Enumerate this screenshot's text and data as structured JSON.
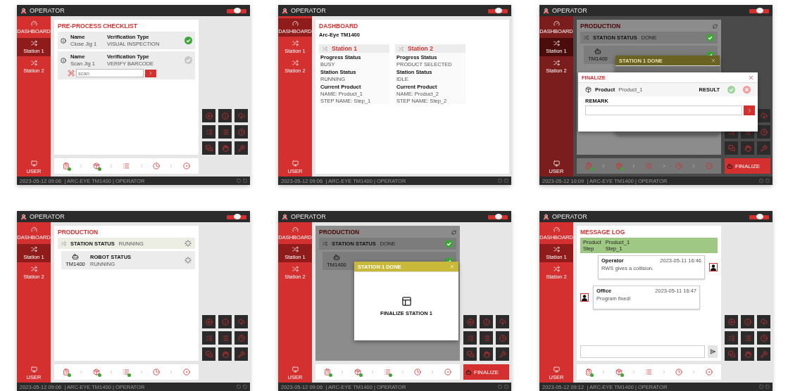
{
  "panels": [
    {
      "kind": "checklist",
      "header": {
        "title": "OPERATOR"
      },
      "sidebar": {
        "items": [
          {
            "label": "DASHBOARD",
            "selected": false
          },
          {
            "label": "Station 1",
            "selected": true
          },
          {
            "label": "Station 2",
            "selected": false
          }
        ],
        "user": "USER"
      },
      "content": {
        "title": "PRE-PROCESS CHECKLIST",
        "items": [
          {
            "name_label": "Name",
            "name": "Close Jig 1",
            "type_label": "Verification Type",
            "type": "VISUAL INSPECTION",
            "checked": true
          },
          {
            "name_label": "Name",
            "name": "Scan Jig 1",
            "type_label": "Verification Type",
            "type": "VERIFY BARCODE",
            "checked": false,
            "scan_placeholder": "scan"
          }
        ]
      },
      "actions_visible": true,
      "steps": [
        {
          "done": true
        },
        {
          "done": true
        },
        {
          "done": false
        },
        {
          "done": false
        },
        {
          "done": false
        }
      ],
      "status_bar": "2023-05-12 09:06  | ARC-EYE TM1400 | OPERATOR"
    },
    {
      "kind": "dashboard",
      "header": {
        "title": "OPERATOR"
      },
      "sidebar": {
        "items": [
          {
            "label": "DASHBOARD",
            "selected": true
          },
          {
            "label": "Station 1",
            "selected": false
          },
          {
            "label": "Station 2",
            "selected": false
          }
        ],
        "user": "USER"
      },
      "content": {
        "title": "DASHBOARD",
        "subtitle": "Arc-Eye TM1400",
        "stations": [
          {
            "name": "Station 1",
            "fields": [
              {
                "label": "Progress Status",
                "values": [
                  "BUSY"
                ]
              },
              {
                "label": "Station Status",
                "values": [
                  "RUNNING"
                ]
              },
              {
                "label": "Current Product",
                "values": [
                  "NAME: Product_1",
                  "STEP NAME: Step_1"
                ]
              }
            ]
          },
          {
            "name": "Station 2",
            "fields": [
              {
                "label": "Progress Status",
                "values": [
                  "PRODUCT SELECTED"
                ]
              },
              {
                "label": "Station Status",
                "values": [
                  "IDLE"
                ]
              },
              {
                "label": "Current Product",
                "values": [
                  "NAME: Product_2",
                  "STEP NAME: Step_2"
                ]
              }
            ]
          }
        ]
      },
      "actions_visible": false,
      "status_bar": "2023-05-12 09:06  | ARC-EYE TM1400 | OPERATOR"
    },
    {
      "kind": "production",
      "header": {
        "title": "OPERATOR"
      },
      "sidebar": {
        "items": [
          {
            "label": "DASHBOARD",
            "selected": false
          },
          {
            "label": "Station 1",
            "selected": true
          },
          {
            "label": "Station 2",
            "selected": false
          }
        ],
        "user": "USER"
      },
      "content": {
        "title": "PRODUCTION",
        "station": {
          "label": "STATION STATUS",
          "value": "DONE",
          "done": true
        },
        "robot": {
          "caption": "TM1400",
          "done": true
        }
      },
      "actions_visible": true,
      "steps": [
        {
          "done": true
        },
        {
          "done": true
        },
        {
          "done": false
        },
        {
          "done": false
        },
        {
          "done": false
        }
      ],
      "finalize_button": "FINALIZE",
      "content_dimmed": true,
      "screen_dimmed": true,
      "dialogs": [
        {
          "kind": "notice",
          "title": "STATION 1 DONE",
          "dimmed": true
        },
        {
          "kind": "finalize",
          "title": "FINALIZE",
          "product_label": "Product",
          "product": "Product_1",
          "result_label": "RESULT",
          "remark_label": "REMARK"
        }
      ],
      "status_bar": "2023-05-12 10:09  | ARC-EYE TM1400 | OPERATOR"
    },
    {
      "kind": "production",
      "header": {
        "title": "OPERATOR"
      },
      "sidebar": {
        "items": [
          {
            "label": "DASHBOARD",
            "selected": false
          },
          {
            "label": "Station 1",
            "selected": true
          },
          {
            "label": "Station 2",
            "selected": false
          }
        ],
        "user": "USER"
      },
      "content": {
        "title": "PRODUCTION",
        "station": {
          "label": "STATION STATUS",
          "value": "RUNNING",
          "done": false
        },
        "robot": {
          "caption": "TM1400",
          "label": "ROBOT STATUS",
          "value": "RUNNING",
          "done": false
        }
      },
      "actions_visible": true,
      "steps": [
        {
          "done": true
        },
        {
          "done": true
        },
        {
          "done": true
        },
        {
          "done": false
        },
        {
          "done": false
        }
      ],
      "status_bar": "2023-05-12 09:06  | ARC-EYE TM1400 | OPERATOR"
    },
    {
      "kind": "production",
      "header": {
        "title": "OPERATOR"
      },
      "sidebar": {
        "items": [
          {
            "label": "DASHBOARD",
            "selected": false
          },
          {
            "label": "Station 1",
            "selected": true
          },
          {
            "label": "Station 2",
            "selected": false
          }
        ],
        "user": "USER"
      },
      "content": {
        "title": "PRODUCTION",
        "station": {
          "label": "STATION STATUS",
          "value": "DONE",
          "done": true
        },
        "robot": {
          "caption": "TM1400",
          "done": true
        }
      },
      "actions_visible": true,
      "steps": [
        {
          "done": true
        },
        {
          "done": true
        },
        {
          "done": true
        },
        {
          "done": false
        },
        {
          "done": false
        }
      ],
      "finalize_button": "FINALIZE",
      "content_dimmed": true,
      "screen_dimmed": false,
      "dialogs": [
        {
          "kind": "notice",
          "title": "STATION 1 DONE",
          "caption": "FINALIZE STATION 1",
          "dimmed": false
        }
      ],
      "status_bar": "2023-05-12 09:06  | ARC-EYE TM1400 | OPERATOR"
    },
    {
      "kind": "messages",
      "header": {
        "title": "OPERATOR"
      },
      "sidebar": {
        "items": [
          {
            "label": "DASHBOARD",
            "selected": false
          },
          {
            "label": "Station 1",
            "selected": true
          },
          {
            "label": "Station 2",
            "selected": false
          }
        ],
        "user": "USER"
      },
      "content": {
        "title": "MESSAGE LOG",
        "context": [
          {
            "label": "Product",
            "value": "Product_1"
          },
          {
            "label": "Step",
            "value": "Step_1"
          }
        ],
        "messages": [
          {
            "kind": "outgoing",
            "sender": "Operator",
            "time": "2023-05-11 16:46",
            "text": "RWS gives a collision."
          },
          {
            "kind": "incoming",
            "sender": "Office",
            "time": "2023-05-11 16:47",
            "text": "Program fixed!"
          }
        ]
      },
      "actions_visible": true,
      "steps": [
        {
          "done": true
        },
        {
          "done": true
        },
        {
          "done": false
        },
        {
          "done": false
        },
        {
          "done": false
        }
      ],
      "status_bar": "2023-05-12 09:12  | ARC-EYE TM1400 | OPERATOR"
    }
  ]
}
